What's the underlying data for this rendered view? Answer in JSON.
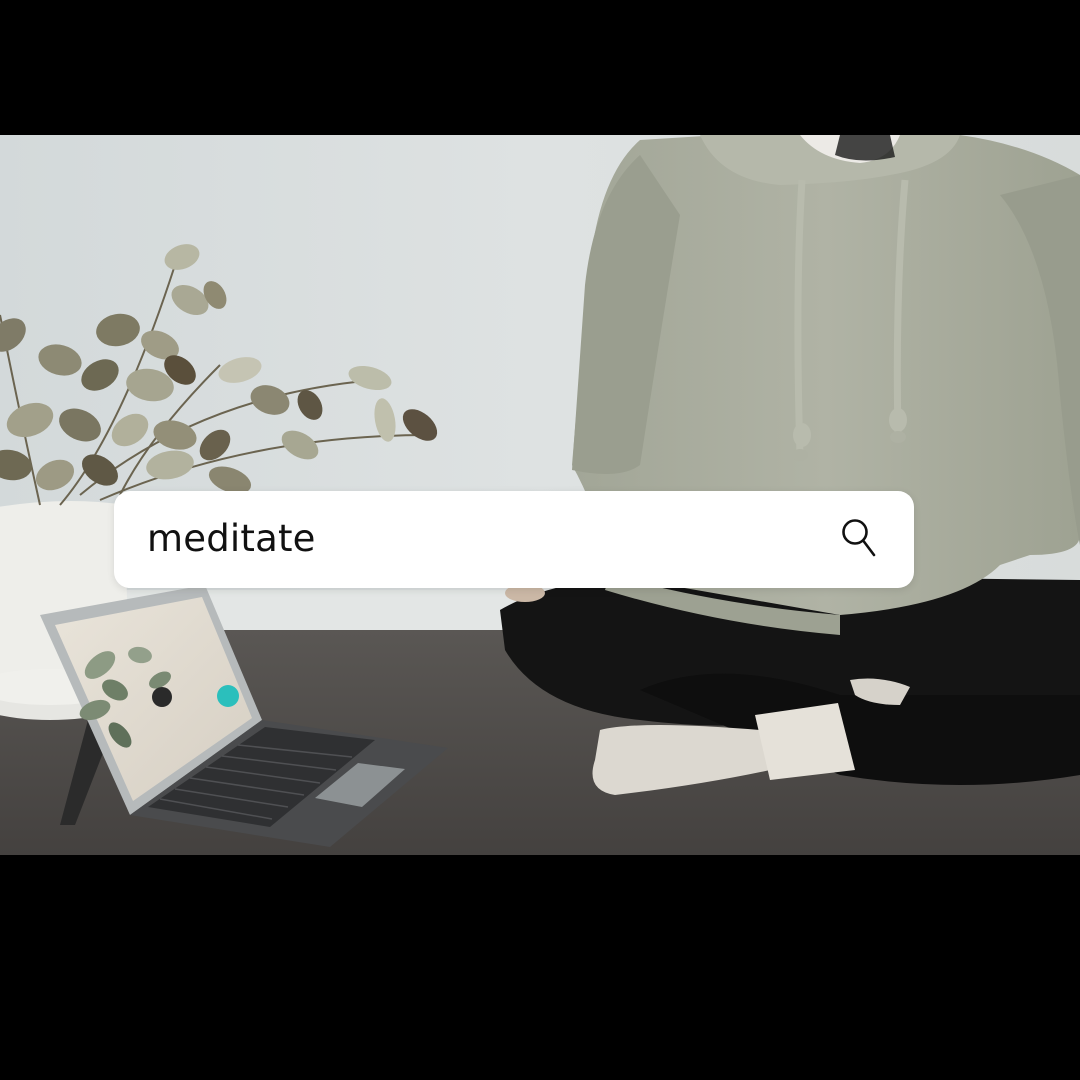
{
  "search": {
    "value": "meditate",
    "icon": "search-icon"
  },
  "colors": {
    "background": "#000000",
    "search_bar": "#ffffff",
    "search_text": "#111111",
    "hoodie": "#a7ab9c",
    "floor": "#4e4b48",
    "wall": "#d7dcdc"
  },
  "photo": {
    "scene": [
      "wall",
      "floor",
      "plant-pot",
      "eucalyptus-plant",
      "laptop",
      "person-in-hoodie"
    ]
  }
}
